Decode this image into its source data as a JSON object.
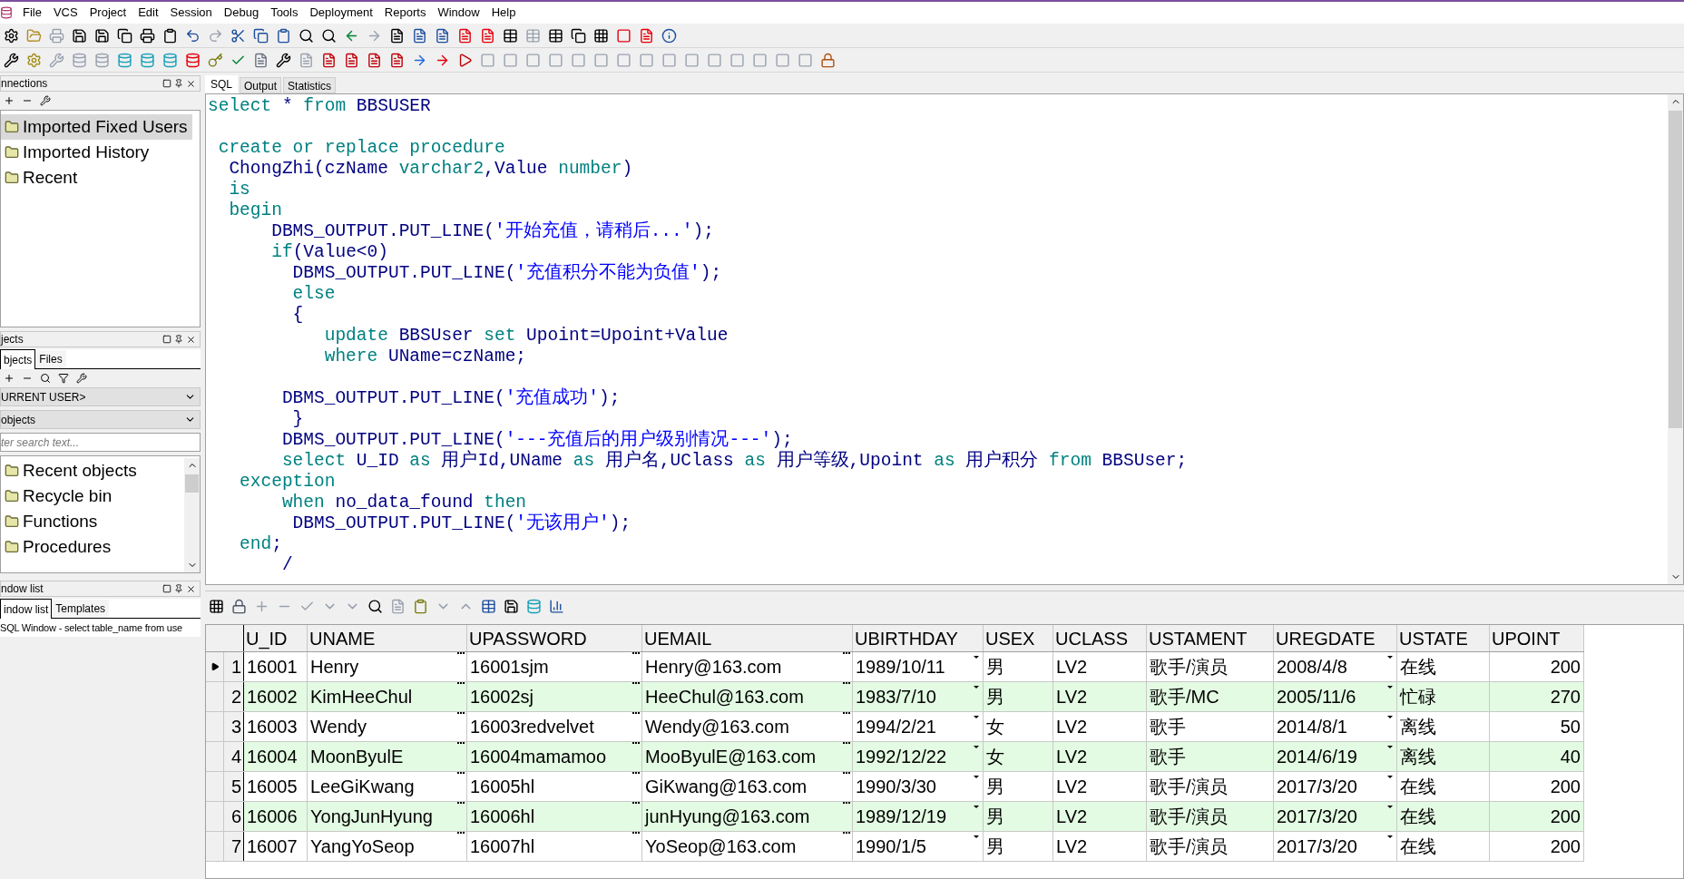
{
  "menu": [
    "File",
    "VCS",
    "Project",
    "Edit",
    "Session",
    "Debug",
    "Tools",
    "Deployment",
    "Reports",
    "Window",
    "Help"
  ],
  "connections": {
    "title": "nnections",
    "items": [
      {
        "label": "Imported Fixed Users",
        "selected": true
      },
      {
        "label": "Imported History",
        "selected": false
      },
      {
        "label": "Recent",
        "selected": false
      }
    ]
  },
  "objects": {
    "title": "jects",
    "tabs": [
      {
        "label": "bjects",
        "selected": true
      },
      {
        "label": "Files",
        "selected": false
      }
    ],
    "owner_select": "URRENT USER>",
    "type_select": "objects",
    "search": {
      "placeholder": "ter search text..."
    },
    "items": [
      {
        "label": "Recent objects",
        "selected": false
      },
      {
        "label": "Recycle bin",
        "selected": false
      },
      {
        "label": "Functions",
        "selected": false
      },
      {
        "label": "Procedures",
        "selected": false
      }
    ]
  },
  "window_list": {
    "title": "ndow list",
    "tabs": [
      {
        "label": "indow list",
        "selected": true
      },
      {
        "label": "Templates",
        "selected": false
      }
    ],
    "items": [
      "SQL Window - select table_name from use"
    ]
  },
  "editor_tabs": [
    {
      "label": "SQL",
      "selected": true
    },
    {
      "label": "Output",
      "selected": false
    },
    {
      "label": "Statistics",
      "selected": false
    }
  ],
  "code_lines": [
    {
      "kind": "code",
      "tokens": [
        {
          "kind": "kw",
          "text": "select"
        },
        {
          "kind": "id",
          "text": " * "
        },
        {
          "kind": "kw",
          "text": "from"
        },
        {
          "kind": "id",
          "text": " BBSUSER"
        }
      ]
    },
    {
      "kind": "blank"
    },
    {
      "kind": "code",
      "tokens": [
        {
          "kind": "kw",
          "text": " create or replace procedure"
        }
      ]
    },
    {
      "kind": "code",
      "tokens": [
        {
          "kind": "id",
          "text": "  ChongZhi(czName "
        },
        {
          "kind": "kw",
          "text": "varchar2"
        },
        {
          "kind": "id",
          "text": ",Value "
        },
        {
          "kind": "kw",
          "text": "number"
        },
        {
          "kind": "id",
          "text": ")"
        }
      ]
    },
    {
      "kind": "code",
      "tokens": [
        {
          "kind": "kw",
          "text": "  is"
        }
      ]
    },
    {
      "kind": "code",
      "tokens": [
        {
          "kind": "kw",
          "text": "  begin"
        }
      ]
    },
    {
      "kind": "code",
      "tokens": [
        {
          "kind": "id",
          "text": "      DBMS_OUTPUT.PUT_LINE("
        },
        {
          "kind": "str",
          "text": "'开始充值，请稍后...'"
        },
        {
          "kind": "id",
          "text": ");"
        }
      ]
    },
    {
      "kind": "code",
      "tokens": [
        {
          "kind": "kw",
          "text": "      if"
        },
        {
          "kind": "id",
          "text": "(Value<0)"
        }
      ]
    },
    {
      "kind": "code",
      "tokens": [
        {
          "kind": "id",
          "text": "        DBMS_OUTPUT.PUT_LINE("
        },
        {
          "kind": "str",
          "text": "'充值积分不能为负值'"
        },
        {
          "kind": "id",
          "text": ");"
        }
      ]
    },
    {
      "kind": "code",
      "tokens": [
        {
          "kind": "kw",
          "text": "        else"
        }
      ]
    },
    {
      "kind": "code",
      "tokens": [
        {
          "kind": "id",
          "text": "        {"
        }
      ]
    },
    {
      "kind": "code",
      "tokens": [
        {
          "kind": "kw",
          "text": "           update"
        },
        {
          "kind": "id",
          "text": " BBSUser "
        },
        {
          "kind": "kw",
          "text": "set"
        },
        {
          "kind": "id",
          "text": " Upoint=Upoint+Value"
        }
      ]
    },
    {
      "kind": "code",
      "tokens": [
        {
          "kind": "kw",
          "text": "           where"
        },
        {
          "kind": "id",
          "text": " UName=czName;"
        }
      ]
    },
    {
      "kind": "blank"
    },
    {
      "kind": "code",
      "tokens": [
        {
          "kind": "id",
          "text": "       DBMS_OUTPUT.PUT_LINE("
        },
        {
          "kind": "str",
          "text": "'充值成功'"
        },
        {
          "kind": "id",
          "text": ");"
        }
      ]
    },
    {
      "kind": "code",
      "tokens": [
        {
          "kind": "id",
          "text": "        }"
        }
      ]
    },
    {
      "kind": "code",
      "tokens": [
        {
          "kind": "id",
          "text": "       DBMS_OUTPUT.PUT_LINE("
        },
        {
          "kind": "str",
          "text": "'---充值后的用户级别情况---'"
        },
        {
          "kind": "id",
          "text": ");"
        }
      ]
    },
    {
      "kind": "code",
      "tokens": [
        {
          "kind": "kw",
          "text": "       select"
        },
        {
          "kind": "id",
          "text": " U_ID "
        },
        {
          "kind": "kw",
          "text": "as"
        },
        {
          "kind": "id",
          "text": " 用户Id,UName "
        },
        {
          "kind": "kw",
          "text": "as"
        },
        {
          "kind": "id",
          "text": " 用户名,UClass "
        },
        {
          "kind": "kw",
          "text": "as"
        },
        {
          "kind": "id",
          "text": " 用户等级,Upoint "
        },
        {
          "kind": "kw",
          "text": "as"
        },
        {
          "kind": "id",
          "text": " 用户积分 "
        },
        {
          "kind": "kw",
          "text": "from"
        },
        {
          "kind": "id",
          "text": " BBSUser;"
        }
      ]
    },
    {
      "kind": "code",
      "tokens": [
        {
          "kind": "kw",
          "text": "   exception"
        }
      ]
    },
    {
      "kind": "code",
      "tokens": [
        {
          "kind": "kw",
          "text": "       when"
        },
        {
          "kind": "id",
          "text": " no_data_found "
        },
        {
          "kind": "kw",
          "text": "then"
        }
      ]
    },
    {
      "kind": "code",
      "tokens": [
        {
          "kind": "id",
          "text": "        DBMS_OUTPUT.PUT_LINE("
        },
        {
          "kind": "str",
          "text": "'无该用户'"
        },
        {
          "kind": "id",
          "text": ");"
        }
      ]
    },
    {
      "kind": "code",
      "tokens": [
        {
          "kind": "kw",
          "text": "   end"
        },
        {
          "kind": "id",
          "text": ";"
        }
      ]
    },
    {
      "kind": "code",
      "tokens": [
        {
          "kind": "id",
          "text": "       /"
        }
      ]
    }
  ],
  "grid": {
    "columns": [
      {
        "name": "U_ID",
        "kind": "plain"
      },
      {
        "name": "UNAME",
        "kind": "ellipsis"
      },
      {
        "name": "UPASSWORD",
        "kind": "ellipsis"
      },
      {
        "name": "UEMAIL",
        "kind": "ellipsis"
      },
      {
        "name": "UBIRTHDAY",
        "kind": "date"
      },
      {
        "name": "USEX",
        "kind": "plain"
      },
      {
        "name": "UCLASS",
        "kind": "plain"
      },
      {
        "name": "USTAMENT",
        "kind": "plain"
      },
      {
        "name": "UREGDATE",
        "kind": "date"
      },
      {
        "name": "USTATE",
        "kind": "plain"
      },
      {
        "name": "UPOINT",
        "kind": "number"
      }
    ],
    "rows": [
      {
        "number": "1",
        "selected": true,
        "cells": [
          "16001",
          "Henry",
          "16001sjm",
          "Henry@163.com",
          "1989/10/11",
          "男",
          "LV2",
          "歌手/演员",
          "2008/4/8",
          "在线",
          "200"
        ]
      },
      {
        "number": "2",
        "selected": false,
        "cells": [
          "16002",
          "KimHeeChul",
          "16002sj",
          "HeeChul@163.com",
          "1983/7/10",
          "男",
          "LV2",
          "歌手/MC",
          "2005/11/6",
          "忙碌",
          "270"
        ]
      },
      {
        "number": "3",
        "selected": false,
        "cells": [
          "16003",
          "Wendy",
          "16003redvelvet",
          "Wendy@163.com",
          "1994/2/21",
          "女",
          "LV2",
          "歌手",
          "2014/8/1",
          "离线",
          "50"
        ]
      },
      {
        "number": "4",
        "selected": false,
        "cells": [
          "16004",
          "MoonByulE",
          "16004mamamoo",
          "MooByulE@163.com",
          "1992/12/22",
          "女",
          "LV2",
          "歌手",
          "2014/6/19",
          "离线",
          "40"
        ]
      },
      {
        "number": "5",
        "selected": false,
        "cells": [
          "16005",
          "LeeGiKwang",
          "16005hl",
          "GiKwang@163.com",
          "1990/3/30",
          "男",
          "LV2",
          "歌手/演员",
          "2017/3/20",
          "在线",
          "200"
        ]
      },
      {
        "number": "6",
        "selected": false,
        "cells": [
          "16006",
          "YongJunHyung",
          "16006hl",
          "junHyung@163.com",
          "1989/12/19",
          "男",
          "LV2",
          "歌手/演员",
          "2017/3/20",
          "在线",
          "200"
        ]
      },
      {
        "number": "7",
        "selected": false,
        "cells": [
          "16007",
          "YangYoSeop",
          "16007hl",
          "YoSeop@163.com",
          "1990/1/5",
          "男",
          "LV2",
          "歌手/演员",
          "2017/3/20",
          "在线",
          "200"
        ]
      }
    ]
  }
}
